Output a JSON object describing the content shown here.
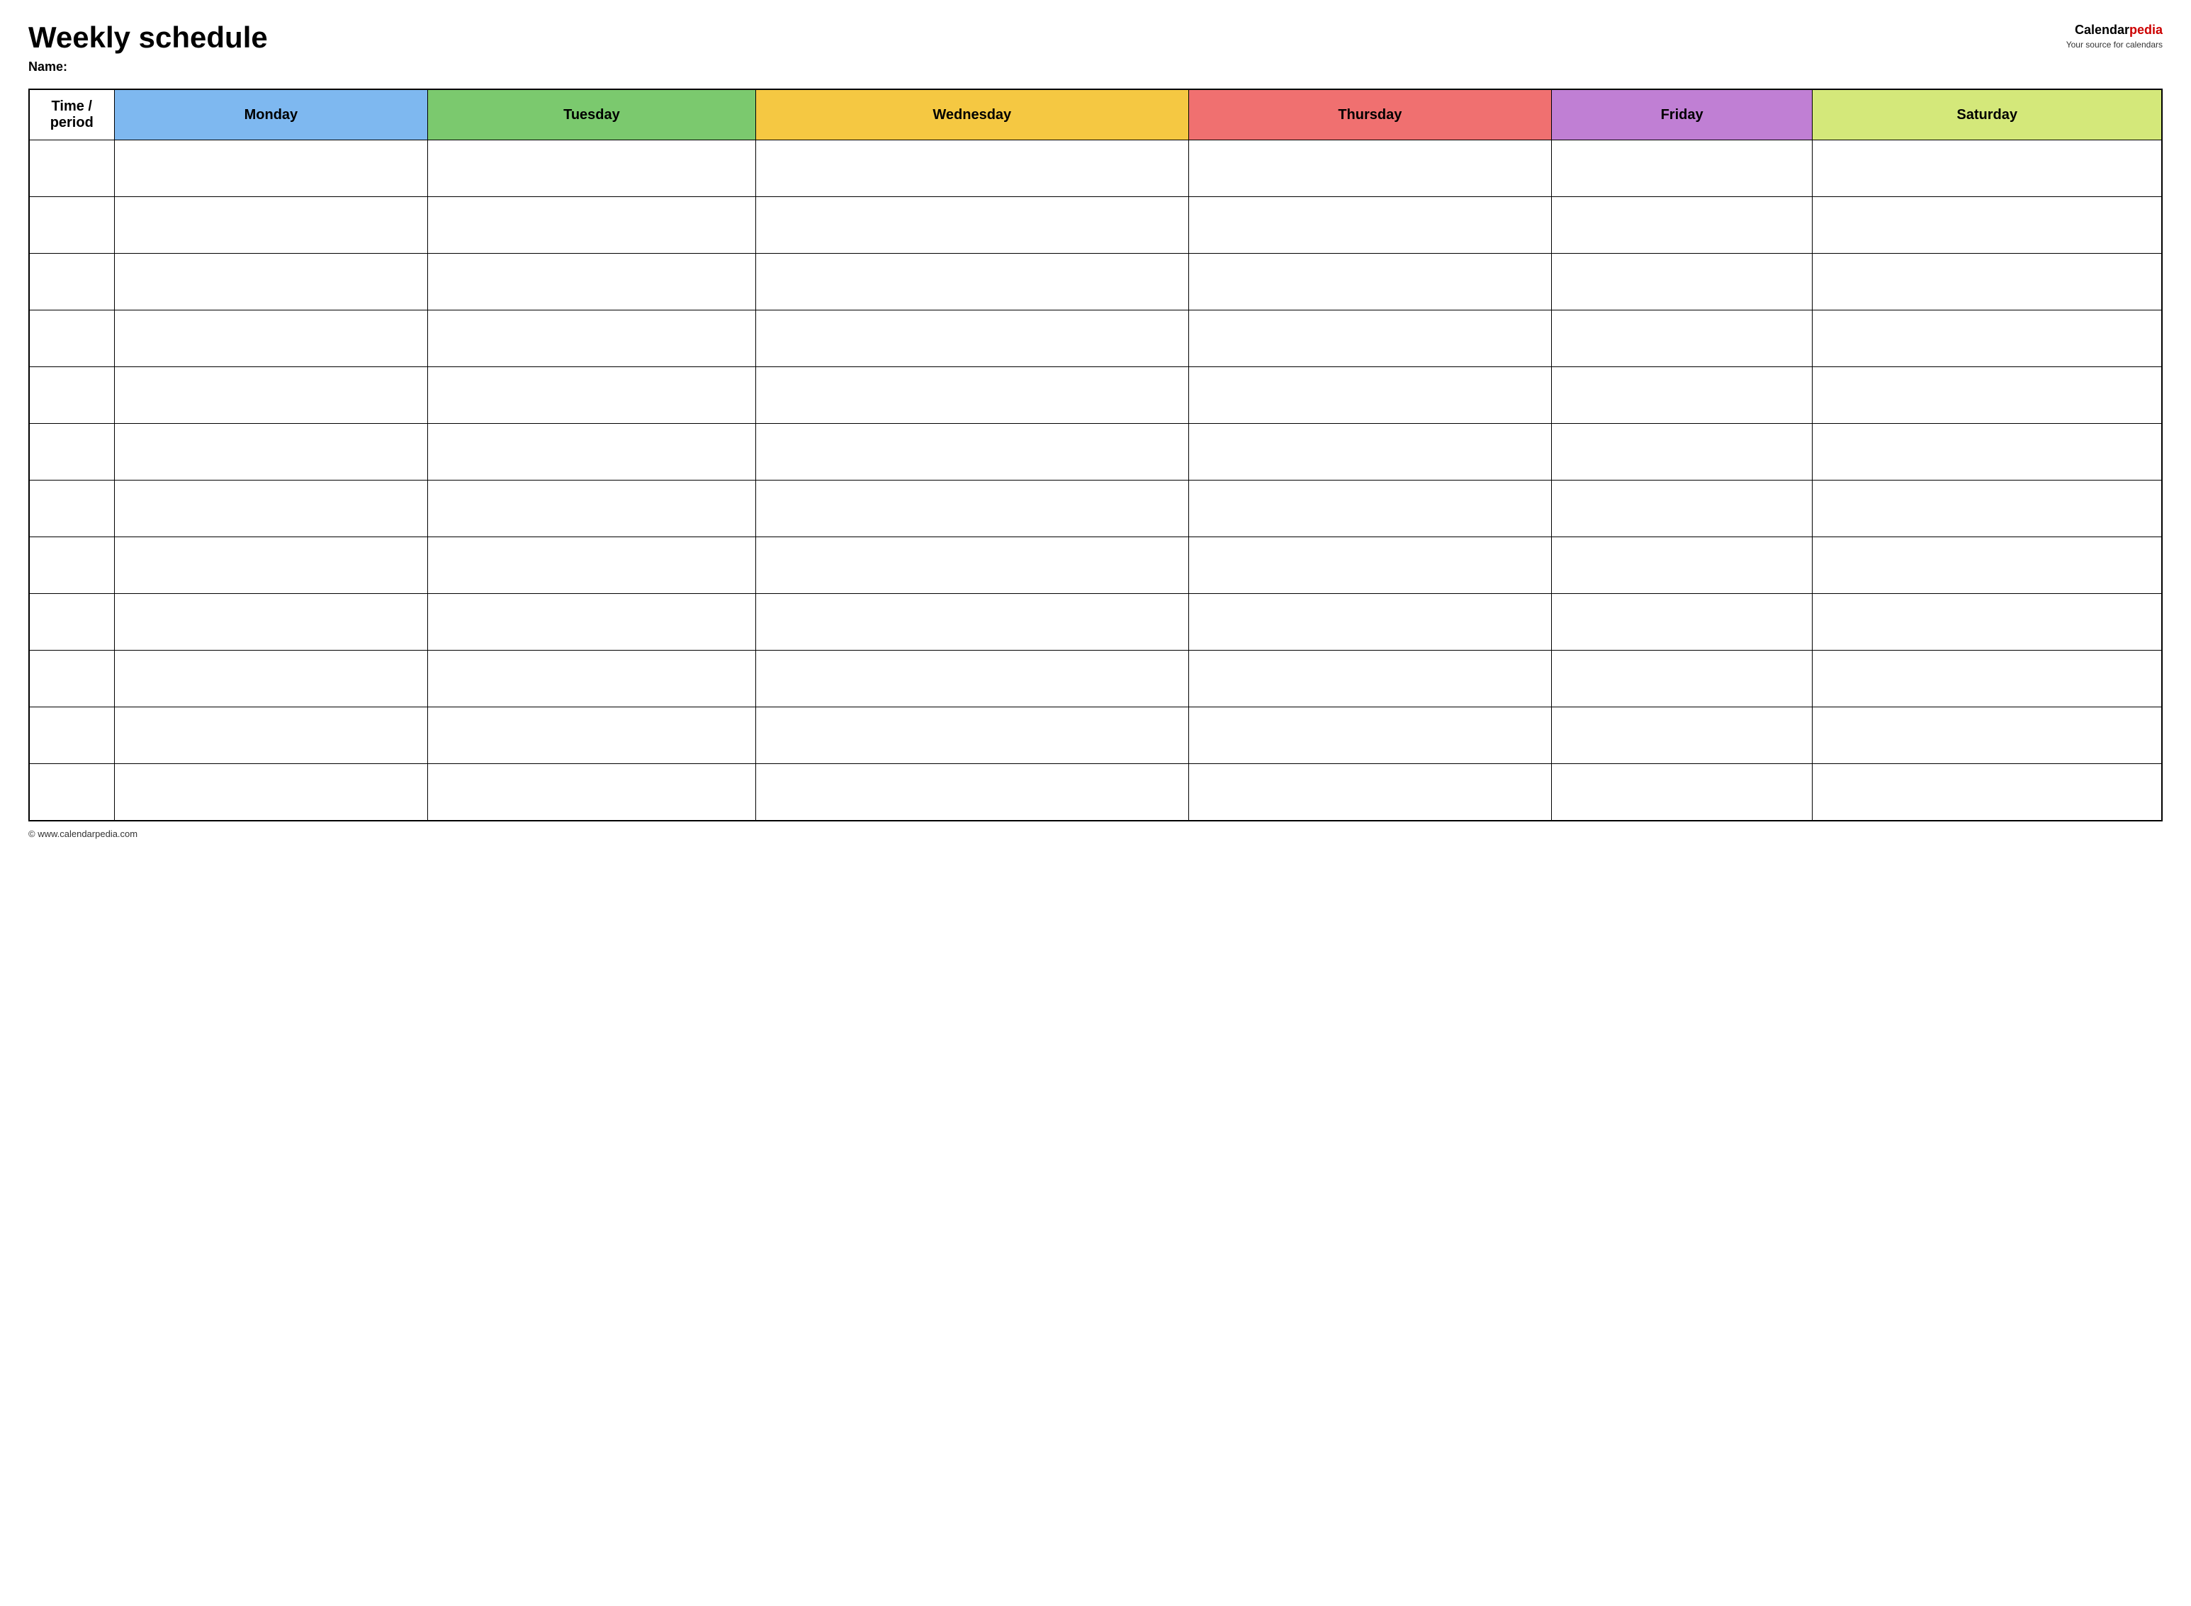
{
  "header": {
    "title": "Weekly schedule",
    "name_label": "Name:",
    "logo": {
      "brand_prefix": "Calendar",
      "brand_suffix": "pedia",
      "tagline": "Your source for calendars"
    }
  },
  "table": {
    "columns": [
      {
        "id": "time",
        "label": "Time / period",
        "color": "#ffffff",
        "class": "th-time"
      },
      {
        "id": "monday",
        "label": "Monday",
        "color": "#7eb8f0",
        "class": "th-monday"
      },
      {
        "id": "tuesday",
        "label": "Tuesday",
        "color": "#7bc96e",
        "class": "th-tuesday"
      },
      {
        "id": "wednesday",
        "label": "Wednesday",
        "color": "#f5c842",
        "class": "th-wednesday"
      },
      {
        "id": "thursday",
        "label": "Thursday",
        "color": "#f07070",
        "class": "th-thursday"
      },
      {
        "id": "friday",
        "label": "Friday",
        "color": "#c07fd4",
        "class": "th-friday"
      },
      {
        "id": "saturday",
        "label": "Saturday",
        "color": "#d4e87a",
        "class": "th-saturday"
      }
    ],
    "row_count": 12
  },
  "footer": {
    "url": "www.calendarpedia.com",
    "text": "© www.calendarpedia.com"
  }
}
